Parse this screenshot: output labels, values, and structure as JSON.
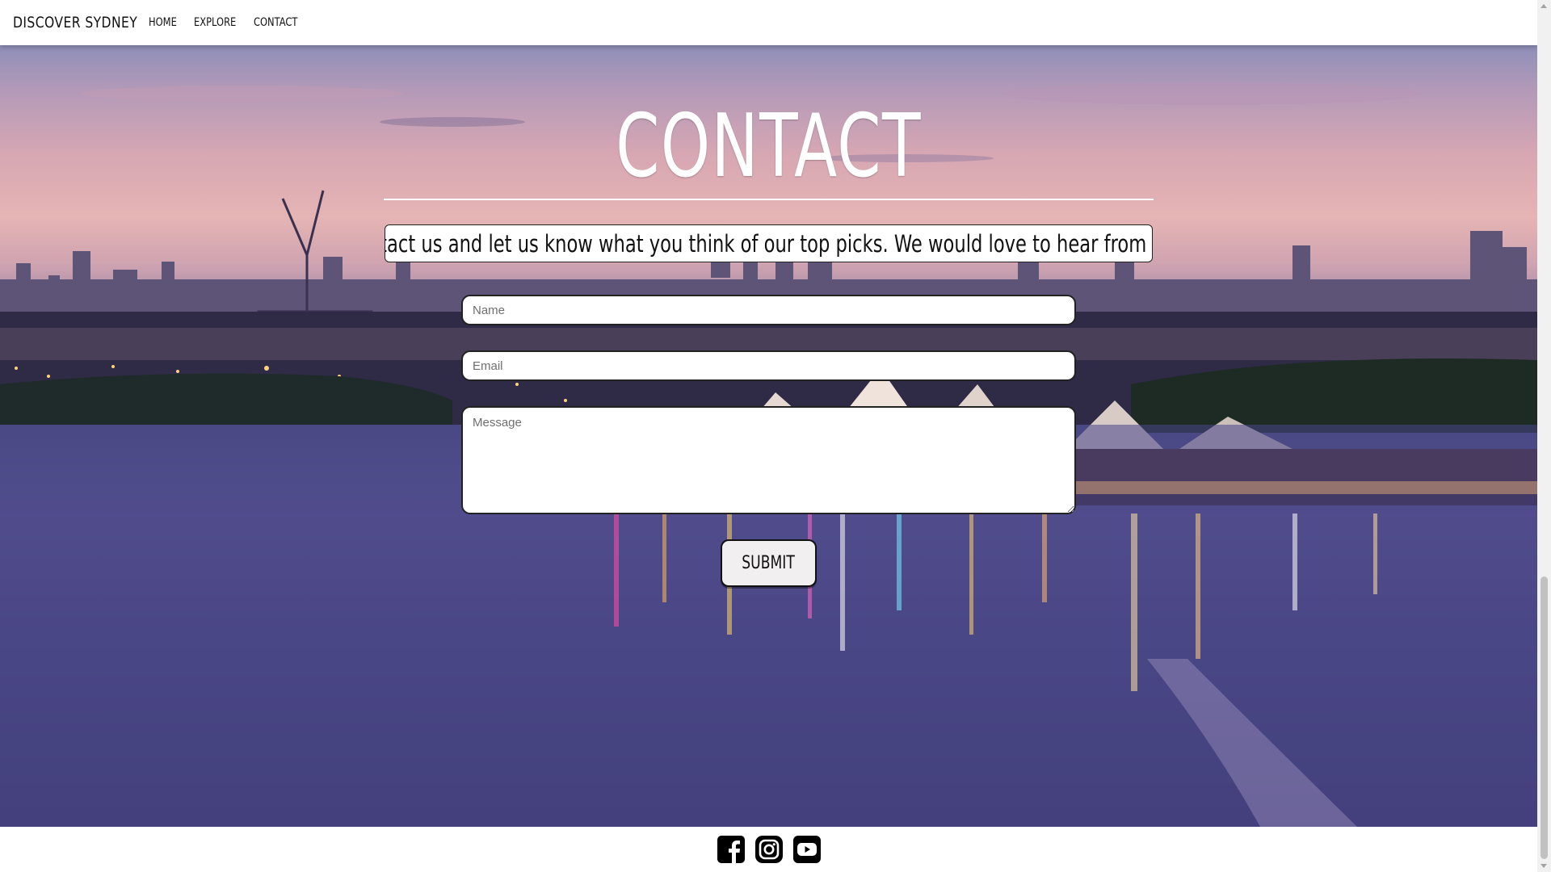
{
  "header": {
    "brand": "DISCOVER SYDNEY",
    "nav": {
      "home": "HOME",
      "explore": "EXPLORE",
      "contact": "CONTACT"
    }
  },
  "main": {
    "title": "CONTACT",
    "intro": "Contact us and let us know what you think of our top picks. We would love to hear from you!",
    "form": {
      "name_placeholder": "Name",
      "email_placeholder": "Email",
      "message_placeholder": "Message",
      "submit_label": "SUBMIT"
    }
  },
  "footer": {
    "social": [
      "facebook-icon",
      "instagram-icon",
      "youtube-icon"
    ]
  },
  "colors": {
    "header_bg": "#ffffff",
    "title": "#ffffff",
    "text": "#111111"
  }
}
